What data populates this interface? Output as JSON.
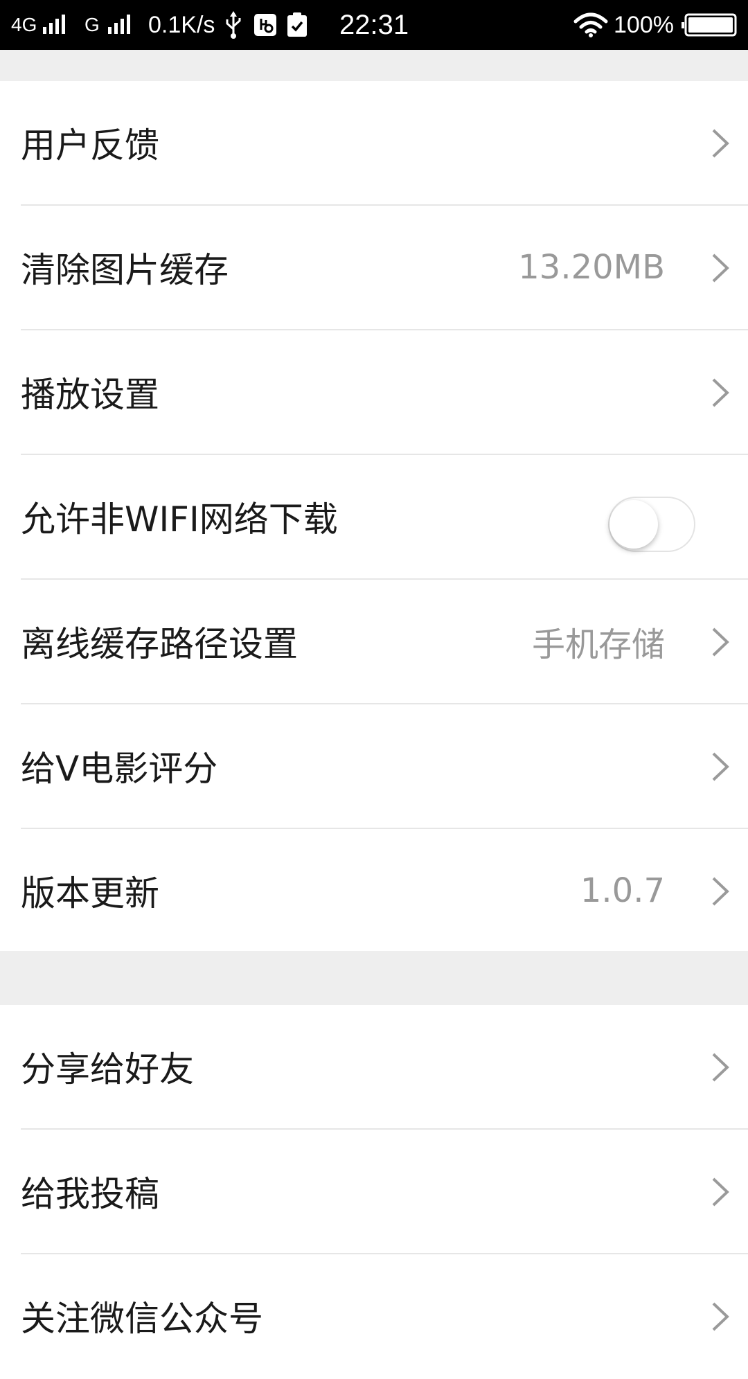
{
  "status_bar": {
    "network1": "4G",
    "network2": "G",
    "speed": "0.1K/s",
    "time": "22:31",
    "battery": "100%"
  },
  "section1": [
    {
      "label": "用户反馈",
      "value": "",
      "control": "chevron"
    },
    {
      "label": "清除图片缓存",
      "value": "13.20MB",
      "control": "chevron"
    },
    {
      "label": "播放设置",
      "value": "",
      "control": "chevron"
    },
    {
      "label": "允许非WIFI网络下载",
      "value": "",
      "control": "toggle",
      "toggle_on": false
    },
    {
      "label": "离线缓存路径设置",
      "value": "手机存储",
      "control": "chevron"
    },
    {
      "label": "给V电影评分",
      "value": "",
      "control": "chevron"
    },
    {
      "label": "版本更新",
      "value": "1.0.7",
      "control": "chevron"
    }
  ],
  "section2": [
    {
      "label": "分享给好友",
      "control": "chevron"
    },
    {
      "label": "给我投稿",
      "control": "chevron"
    },
    {
      "label": "关注微信公众号",
      "control": "chevron"
    }
  ],
  "colors": {
    "status_bar_bg": "#000000",
    "separator_bg": "#eeeeee",
    "label_text": "#1a1a1a",
    "value_text": "#999999",
    "chevron": "#9a9a9a",
    "divider": "#e6e6e6"
  }
}
